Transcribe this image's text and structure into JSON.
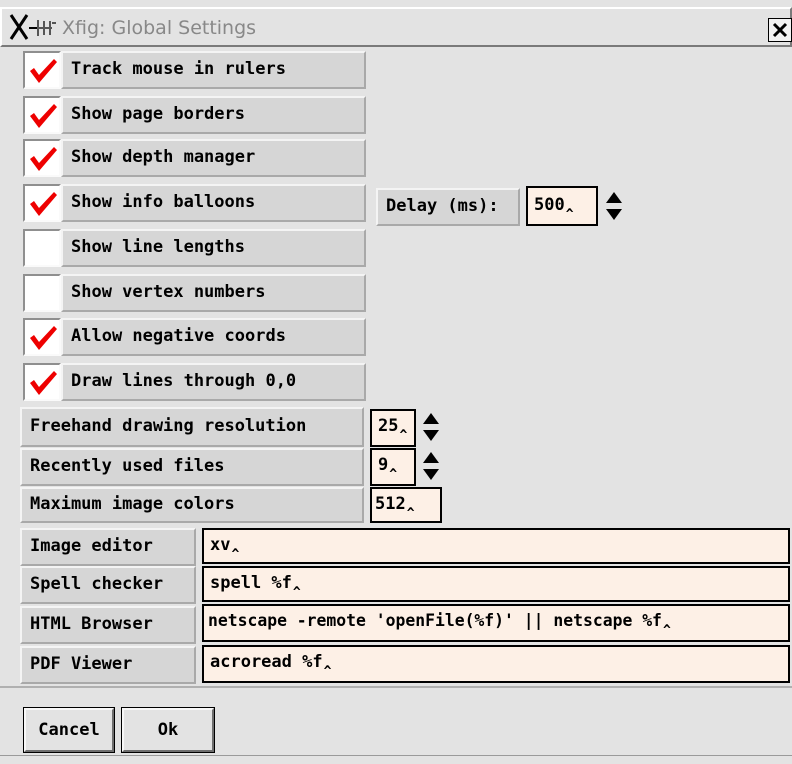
{
  "window": {
    "title": "Xfig: Global Settings"
  },
  "checkboxes": [
    {
      "label": "Track mouse in rulers",
      "checked": true
    },
    {
      "label": "Show page borders",
      "checked": true
    },
    {
      "label": "Show depth manager",
      "checked": true
    },
    {
      "label": "Show info balloons",
      "checked": true
    },
    {
      "label": "Show line lengths",
      "checked": false
    },
    {
      "label": "Show vertex numbers",
      "checked": false
    },
    {
      "label": "Allow negative coords",
      "checked": true
    },
    {
      "label": "Draw lines through 0,0",
      "checked": true
    }
  ],
  "delay": {
    "label": "Delay (ms):",
    "value": "500"
  },
  "numeric": [
    {
      "label": "Freehand drawing resolution",
      "value": "25"
    },
    {
      "label": "Recently used files",
      "value": "9"
    },
    {
      "label": "Maximum image colors",
      "value": "512"
    }
  ],
  "text_fields": [
    {
      "label": "Image editor",
      "value": "xv"
    },
    {
      "label": "Spell checker",
      "value": "spell %f"
    },
    {
      "label": "HTML Browser",
      "value": "netscape -remote 'openFile(%f)' || netscape %f"
    },
    {
      "label": "PDF Viewer",
      "value": "acroread %f"
    }
  ],
  "buttons": {
    "cancel": "Cancel",
    "ok": "Ok"
  },
  "colors": {
    "check": "#ee0000",
    "field_bg": "#fdf0e6",
    "panel": "#d6d6d6",
    "window": "#e3e3e3"
  }
}
